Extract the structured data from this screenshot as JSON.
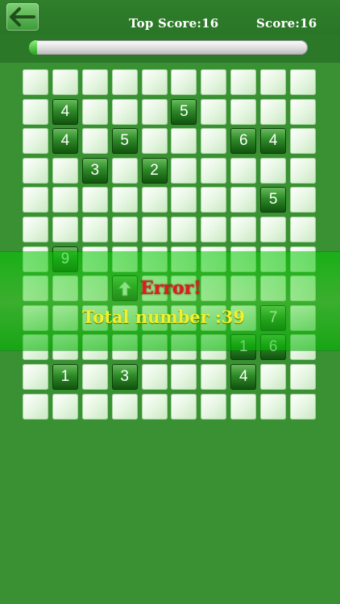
{
  "header": {
    "top_score_label": "Top Score:16",
    "score_label": "Score:16"
  },
  "progress": {
    "fraction": 0.02
  },
  "board": {
    "cols": 10,
    "rows": 12,
    "cells": [
      {
        "r": 1,
        "c": 1,
        "v": "4"
      },
      {
        "r": 1,
        "c": 5,
        "v": "5"
      },
      {
        "r": 2,
        "c": 1,
        "v": "4"
      },
      {
        "r": 2,
        "c": 3,
        "v": "5"
      },
      {
        "r": 2,
        "c": 7,
        "v": "6"
      },
      {
        "r": 2,
        "c": 8,
        "v": "4"
      },
      {
        "r": 3,
        "c": 2,
        "v": "3"
      },
      {
        "r": 3,
        "c": 4,
        "v": "2"
      },
      {
        "r": 4,
        "c": 8,
        "v": "5"
      },
      {
        "r": 6,
        "c": 1,
        "v": "9"
      },
      {
        "r": 7,
        "c": 3,
        "v": "arrow"
      },
      {
        "r": 8,
        "c": 8,
        "v": "7"
      },
      {
        "r": 9,
        "c": 7,
        "v": "1"
      },
      {
        "r": 9,
        "c": 8,
        "v": "6"
      },
      {
        "r": 10,
        "c": 1,
        "v": "1"
      },
      {
        "r": 10,
        "c": 3,
        "v": "3"
      },
      {
        "r": 10,
        "c": 7,
        "v": "4"
      }
    ]
  },
  "overlay": {
    "error_text": "Error!",
    "total_text": "Total number :39"
  },
  "colors": {
    "background": "#3a9134",
    "error": "#e01b1b",
    "total": "#f1f22b",
    "tile_dark": "#2e8a28"
  },
  "icons": {
    "back": "back-arrow-icon",
    "hint": "up-arrow-icon"
  }
}
